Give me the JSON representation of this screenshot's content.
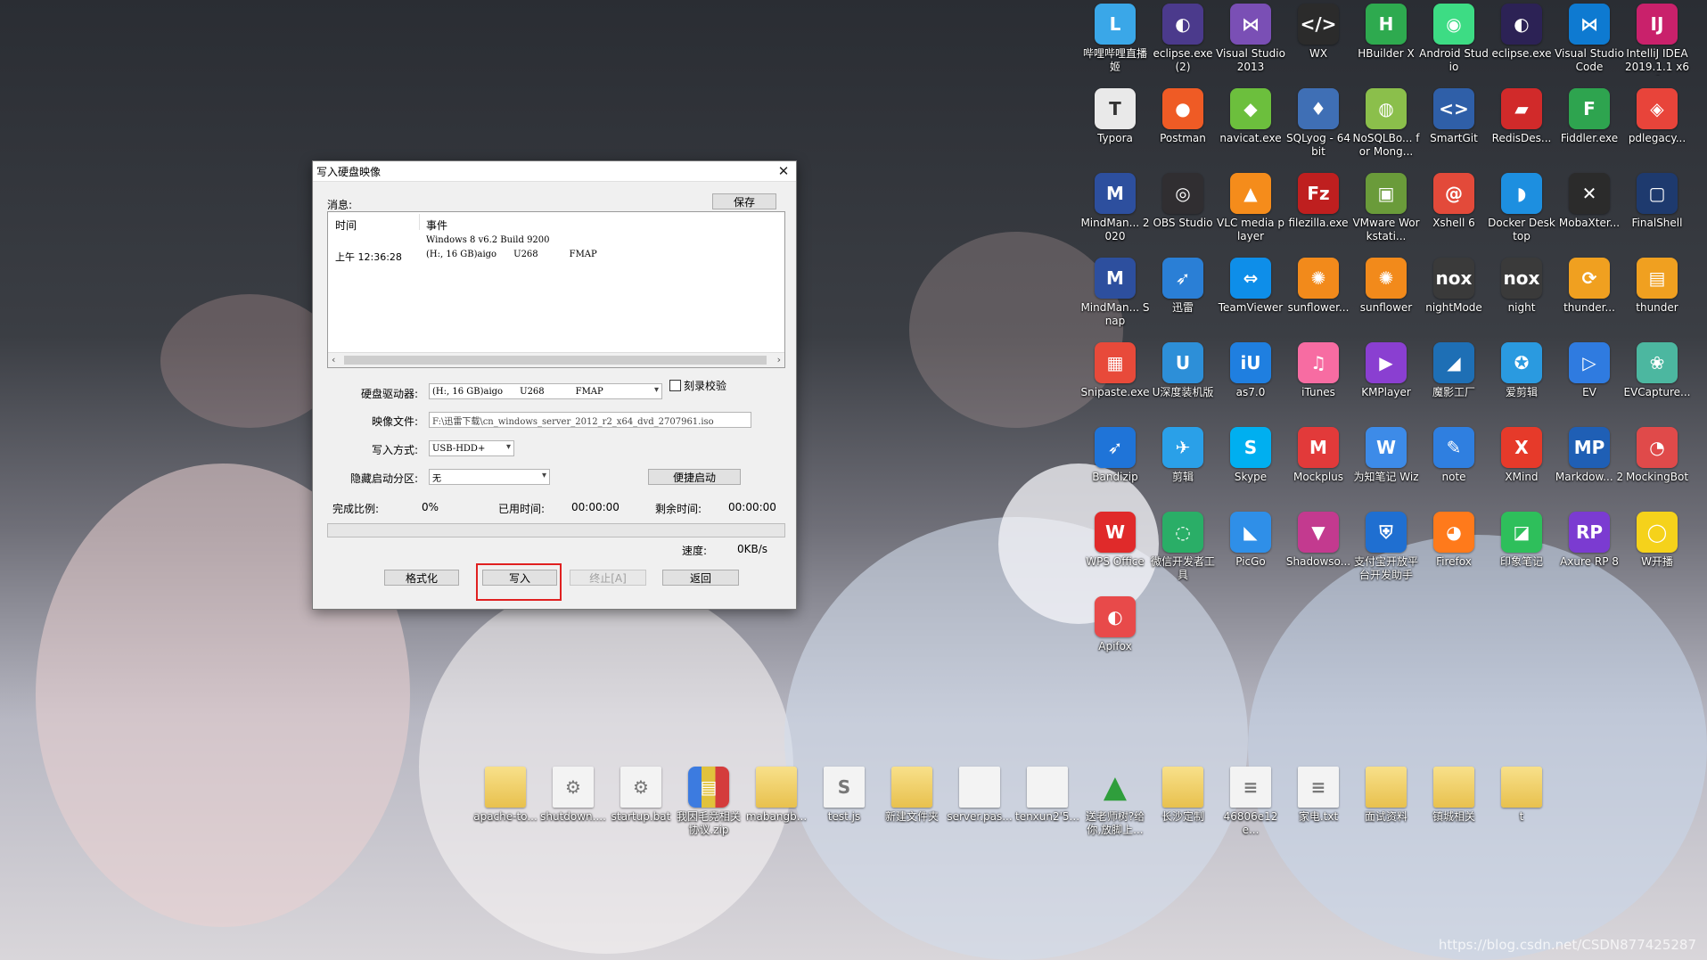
{
  "desktop": {
    "watermark": "https://blog.csdn.net/CSDN877425287",
    "icons": [
      {
        "label": "哔哩哔哩直播姬",
        "glyph": "L",
        "color": "#3aa7e8"
      },
      {
        "label": "eclipse.exe (2)",
        "glyph": "◐",
        "color": "#4b3a8c"
      },
      {
        "label": "Visual Studio 2013",
        "glyph": "⋈",
        "color": "#7a4fb5"
      },
      {
        "label": "WX",
        "glyph": "</>",
        "color": "#2b2b2b"
      },
      {
        "label": "HBuilder X",
        "glyph": "H",
        "color": "#2eaa4f"
      },
      {
        "label": "Android Studio",
        "glyph": "◉",
        "color": "#3ddc84"
      },
      {
        "label": "eclipse.exe",
        "glyph": "◐",
        "color": "#2c2255"
      },
      {
        "label": "Visual Studio Code",
        "glyph": "⋈",
        "color": "#0e7ad1"
      },
      {
        "label": "IntelliJ IDEA 2019.1.1 x64",
        "glyph": "IJ",
        "color": "#c9216b"
      },
      {
        "label": "Typora",
        "glyph": "T",
        "color": "#e9e9e9"
      },
      {
        "label": "Postman",
        "glyph": "●",
        "color": "#ef5b25"
      },
      {
        "label": "navicat.exe",
        "glyph": "◆",
        "color": "#6cbf3d"
      },
      {
        "label": "SQLyog - 64 bit",
        "glyph": "♦",
        "color": "#3f6fb5"
      },
      {
        "label": "NoSQLBo... for Mong...",
        "glyph": "◍",
        "color": "#8bbf4b"
      },
      {
        "label": "SmartGit",
        "glyph": "<>",
        "color": "#2f5fa8"
      },
      {
        "label": "RedisDes...",
        "glyph": "▰",
        "color": "#d12a2a"
      },
      {
        "label": "Fiddler.exe",
        "glyph": "F",
        "color": "#2ea44f"
      },
      {
        "label": "pdlegacy...",
        "glyph": "◈",
        "color": "#e8443a"
      },
      {
        "label": "MindMan... 2020",
        "glyph": "M",
        "color": "#2d4f9e"
      },
      {
        "label": "OBS Studio",
        "glyph": "◎",
        "color": "#302e31"
      },
      {
        "label": "VLC media player",
        "glyph": "▲",
        "color": "#f58c1b"
      },
      {
        "label": "filezilla.exe",
        "glyph": "Fz",
        "color": "#bf1f1f"
      },
      {
        "label": "VMware Workstati...",
        "glyph": "▣",
        "color": "#6a9b3a"
      },
      {
        "label": "Xshell 6",
        "glyph": "@",
        "color": "#e34a3a"
      },
      {
        "label": "Docker Desktop",
        "glyph": "◗",
        "color": "#1d8fe0"
      },
      {
        "label": "MobaXter...",
        "glyph": "✕",
        "color": "#2b2b2b"
      },
      {
        "label": "FinalShell",
        "glyph": "▢",
        "color": "#1e3a6e"
      },
      {
        "label": "MindMan... Snap",
        "glyph": "M",
        "color": "#2d4f9e"
      },
      {
        "label": "迅雷",
        "glyph": "➶",
        "color": "#2a7fd6"
      },
      {
        "label": "TeamViewer",
        "glyph": "⇔",
        "color": "#0e8ee9"
      },
      {
        "label": "sunflower...",
        "glyph": "✺",
        "color": "#f28a1b"
      },
      {
        "label": "sunflower",
        "glyph": "✺",
        "color": "#f28a1b"
      },
      {
        "label": "nightMode",
        "glyph": "nox",
        "color": "#3a3a3a"
      },
      {
        "label": "night",
        "glyph": "nox",
        "color": "#3a3a3a"
      },
      {
        "label": "thunder...",
        "glyph": "⟳",
        "color": "#f0a020"
      },
      {
        "label": "thunder",
        "glyph": "▤",
        "color": "#f0a020"
      },
      {
        "label": "Snipaste.exe",
        "glyph": "▦",
        "color": "#e84a3a"
      },
      {
        "label": "U深度装机版",
        "glyph": "U",
        "color": "#2d8fd8"
      },
      {
        "label": "as7.0",
        "glyph": "iU",
        "color": "#1f7fe0"
      },
      {
        "label": "iTunes",
        "glyph": "♫",
        "color": "#f76ca2"
      },
      {
        "label": "KMPlayer",
        "glyph": "▶",
        "color": "#8a3fd1"
      },
      {
        "label": "魔影工厂",
        "glyph": "◢",
        "color": "#1e6fb5"
      },
      {
        "label": "爱剪辑",
        "glyph": "✪",
        "color": "#2a9ae0"
      },
      {
        "label": "EV",
        "glyph": "▷",
        "color": "#2f7be0"
      },
      {
        "label": "EVCapture...",
        "glyph": "❀",
        "color": "#4cb7a0"
      },
      {
        "label": "Bandizip",
        "glyph": "➶",
        "color": "#1f74d8"
      },
      {
        "label": "剪辑",
        "glyph": "✈",
        "color": "#2aa0e8"
      },
      {
        "label": "Skype",
        "glyph": "S",
        "color": "#00aff0"
      },
      {
        "label": "Mockplus",
        "glyph": "M",
        "color": "#e23a3a"
      },
      {
        "label": "为知笔记 Wiz",
        "glyph": "W",
        "color": "#3d8be8"
      },
      {
        "label": "note",
        "glyph": "✎",
        "color": "#2f7fe0"
      },
      {
        "label": "XMind",
        "glyph": "X",
        "color": "#e63a2a"
      },
      {
        "label": "Markdow... 2",
        "glyph": "MP",
        "color": "#1f5fb5"
      },
      {
        "label": "MockingBot",
        "glyph": "◔",
        "color": "#e04a4a"
      },
      {
        "label": "WPS Office",
        "glyph": "W",
        "color": "#e02a2a"
      },
      {
        "label": "微信开发者工具",
        "glyph": "◌",
        "color": "#2aae67"
      },
      {
        "label": "PicGo",
        "glyph": "◣",
        "color": "#2f8fe8"
      },
      {
        "label": "Shadowso...",
        "glyph": "▼",
        "color": "#c33a8f"
      },
      {
        "label": "支付宝开放平台开发助手",
        "glyph": "⛨",
        "color": "#1f6fd1"
      },
      {
        "label": "Firefox",
        "glyph": "◕",
        "color": "#ff7a1b"
      },
      {
        "label": "印象笔记",
        "glyph": "◪",
        "color": "#2ebf5b"
      },
      {
        "label": "Axure RP 8",
        "glyph": "RP",
        "color": "#7b3bd1"
      },
      {
        "label": "W开播",
        "glyph": "◯",
        "color": "#f5d21b"
      },
      {
        "label": "Apifox",
        "glyph": "◐",
        "color": "#e84a4a"
      }
    ],
    "bottom_icons": [
      {
        "label": "apache-to...",
        "kind": "folder"
      },
      {
        "label": "shutdown....",
        "kind": "file",
        "glyph": "⚙"
      },
      {
        "label": "startup.bat",
        "kind": "file",
        "glyph": "⚙"
      },
      {
        "label": "我因毛竞相关协议.zip",
        "kind": "zip"
      },
      {
        "label": "mabangb...",
        "kind": "folder"
      },
      {
        "label": "test.js",
        "kind": "file",
        "glyph": "S"
      },
      {
        "label": "新建文件夹",
        "kind": "folder"
      },
      {
        "label": "server.pas...",
        "kind": "file",
        "glyph": ""
      },
      {
        "label": "tenxun2'5...",
        "kind": "file",
        "glyph": ""
      },
      {
        "label": "送老师树?给你,放脚上...",
        "kind": "tree"
      },
      {
        "label": "长沙定制",
        "kind": "folder"
      },
      {
        "label": "46806e12e...",
        "kind": "file",
        "glyph": "≡"
      },
      {
        "label": "家电.txt",
        "kind": "file",
        "glyph": "≡"
      },
      {
        "label": "面试资料",
        "kind": "folder"
      },
      {
        "label": "镇城相关",
        "kind": "folder"
      },
      {
        "label": "t",
        "kind": "folder"
      }
    ]
  },
  "dialog": {
    "title": "写入硬盘映像",
    "messages_label": "消息:",
    "save_button": "保存",
    "log": {
      "col_time": "时间",
      "col_event": "事件",
      "row1_event": "Windows 8 v6.2 Build 9200",
      "row2_time": "上午 12:36:28",
      "row2_event": "(H:, 16 GB)aigo      U268           FMAP"
    },
    "drive_label": "硬盘驱动器:",
    "drive_value": "(H:, 16 GB)aigo      U268           FMAP",
    "verify_label": "刻录校验",
    "image_label": "映像文件:",
    "image_value": "F:\\迅雷下载\\cn_windows_server_2012_r2_x64_dvd_2707961.iso",
    "write_mode_label": "写入方式:",
    "write_mode_value": "USB-HDD+",
    "hidden_part_label": "隐藏启动分区:",
    "hidden_part_value": "无",
    "quick_boot_button": "便捷启动",
    "progress_label": "完成比例:",
    "progress_value": "0%",
    "progress_fraction": 0,
    "elapsed_label": "已用时间:",
    "elapsed_value": "00:00:00",
    "remaining_label": "剩余时间:",
    "remaining_value": "00:00:00",
    "speed_label": "速度:",
    "speed_value": "0KB/s",
    "format_button": "格式化",
    "write_button": "写入",
    "stop_button": "终止[A]",
    "back_button": "返回"
  }
}
